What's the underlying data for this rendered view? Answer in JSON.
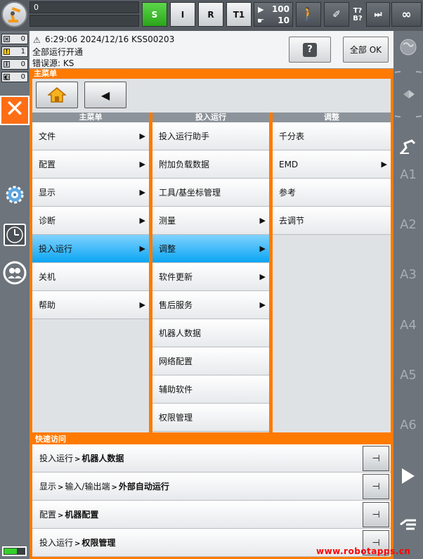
{
  "topbar": {
    "program_line1": "0",
    "program_line2": "",
    "mode_s": "S",
    "mode_i": "I",
    "mode_r": "R",
    "op_mode": "T1",
    "override_run": "100",
    "override_jog": "10",
    "tb_t": "T?",
    "tb_b": "B?",
    "increment": "∞"
  },
  "message_counts": {
    "error": "0",
    "warning": "1",
    "info": "0",
    "wait": "0"
  },
  "message": {
    "line1": "6:29:06 2024/12/16 KSS00203",
    "line2": "全部运行开通",
    "line3": "错误源: KS",
    "help_label": "?",
    "ack_all_label": "全部 OK"
  },
  "main_menu": {
    "header": "主菜单",
    "col1": {
      "title": "主菜单",
      "items": [
        {
          "label": "文件",
          "arrow": "▶"
        },
        {
          "label": "配置",
          "arrow": "▶"
        },
        {
          "label": "显示",
          "arrow": "▶"
        },
        {
          "label": "诊断",
          "arrow": "▶"
        },
        {
          "label": "投入运行",
          "arrow": "▶"
        },
        {
          "label": "关机",
          "arrow": ""
        },
        {
          "label": "帮助",
          "arrow": "▶"
        }
      ]
    },
    "col2": {
      "title": "投入运行",
      "items": [
        {
          "label": "投入运行助手",
          "arrow": ""
        },
        {
          "label": "附加负载数据",
          "arrow": ""
        },
        {
          "label": "工具/基坐标管理",
          "arrow": ""
        },
        {
          "label": "测量",
          "arrow": "▶"
        },
        {
          "label": "调整",
          "arrow": "▶"
        },
        {
          "label": "软件更新",
          "arrow": "▶"
        },
        {
          "label": "售后服务",
          "arrow": "▶"
        },
        {
          "label": "机器人数据",
          "arrow": ""
        },
        {
          "label": "网络配置",
          "arrow": ""
        },
        {
          "label": "辅助软件",
          "arrow": ""
        },
        {
          "label": "权限管理",
          "arrow": ""
        }
      ]
    },
    "col3": {
      "title": "调整",
      "items": [
        {
          "label": "千分表",
          "arrow": ""
        },
        {
          "label": "EMD",
          "arrow": "▶"
        },
        {
          "label": "参考",
          "arrow": ""
        },
        {
          "label": "去调节",
          "arrow": ""
        }
      ]
    }
  },
  "quick_access": {
    "header": "快速访问",
    "rows": [
      {
        "path1": "投入运行",
        "path2": "",
        "target": "机器人数据"
      },
      {
        "path1": "显示",
        "path2": "输入/输出端",
        "target": "外部自动运行"
      },
      {
        "path1": "配置",
        "path2": "",
        "target": "机器配置"
      },
      {
        "path1": "投入运行",
        "path2": "",
        "target": "权限管理"
      }
    ]
  },
  "axes": {
    "a1": "A1",
    "a2": "A2",
    "a3": "A3",
    "a4": "A4",
    "a5": "A5",
    "a6": "A6"
  },
  "watermark": "www.robotapps.cn",
  "battery_level": 0.55
}
